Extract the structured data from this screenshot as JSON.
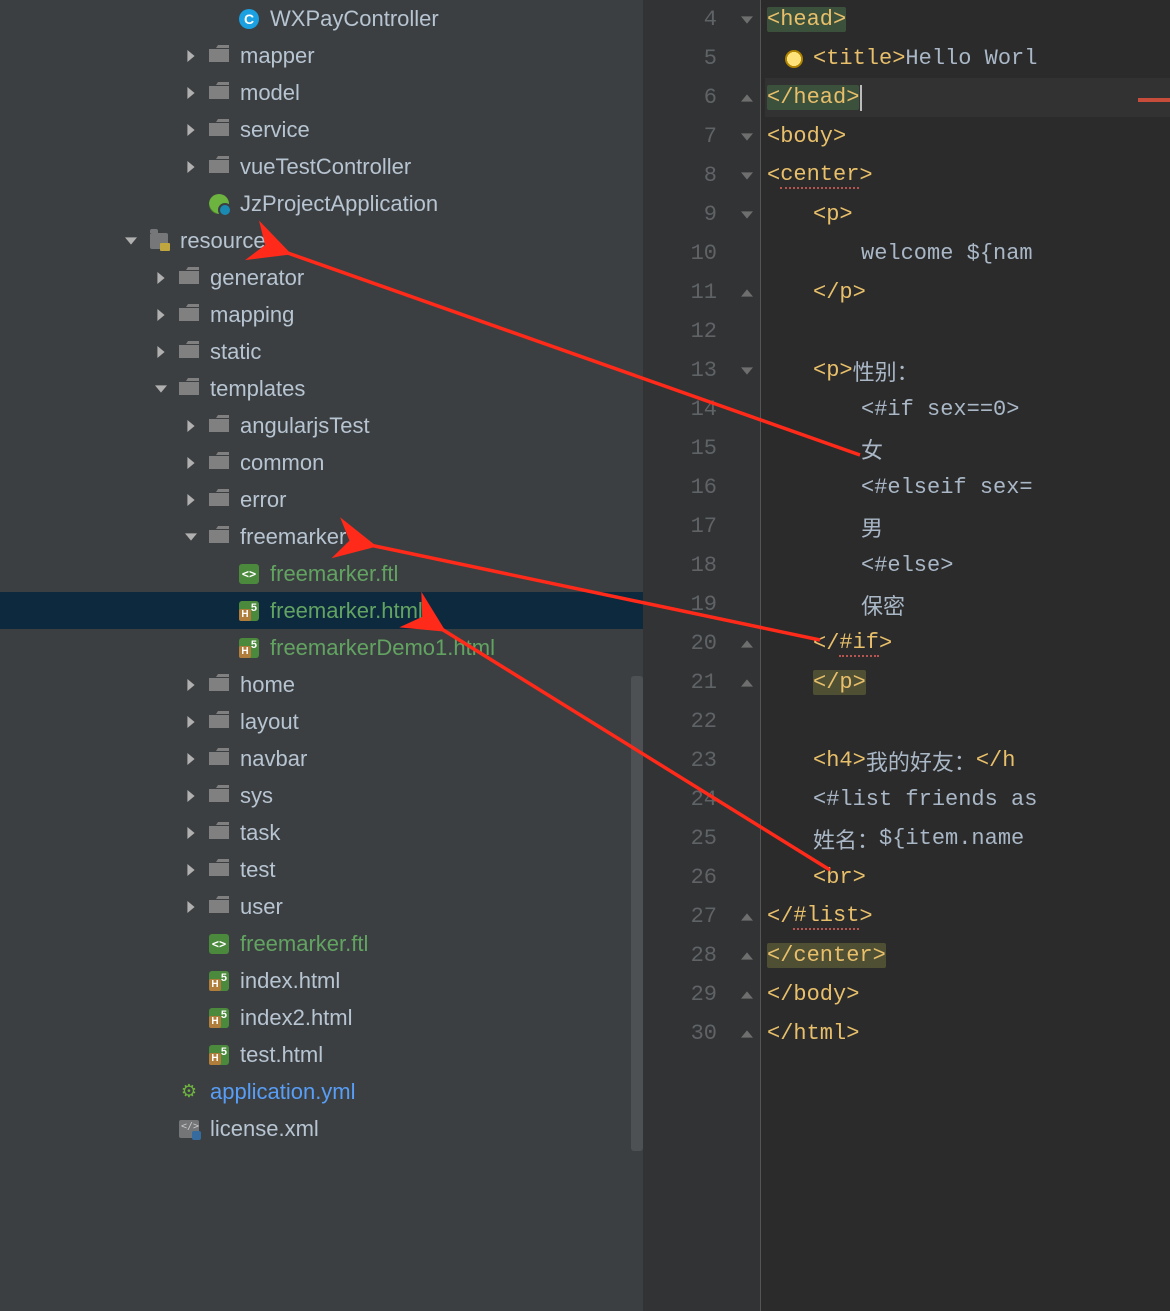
{
  "tree": {
    "rows": [
      {
        "depth": 5,
        "arrow": "none",
        "icon": "class",
        "label": "WXPayController",
        "cls": ""
      },
      {
        "depth": 4,
        "arrow": "right",
        "icon": "folder",
        "label": "mapper",
        "cls": ""
      },
      {
        "depth": 4,
        "arrow": "right",
        "icon": "folder",
        "label": "model",
        "cls": ""
      },
      {
        "depth": 4,
        "arrow": "right",
        "icon": "folder",
        "label": "service",
        "cls": ""
      },
      {
        "depth": 4,
        "arrow": "right",
        "icon": "folder",
        "label": "vueTestController",
        "cls": ""
      },
      {
        "depth": 4,
        "arrow": "none",
        "icon": "spring",
        "label": "JzProjectApplication",
        "cls": ""
      },
      {
        "depth": 2,
        "arrow": "down",
        "icon": "res",
        "label": "resources",
        "cls": ""
      },
      {
        "depth": 3,
        "arrow": "right",
        "icon": "folder",
        "label": "generator",
        "cls": ""
      },
      {
        "depth": 3,
        "arrow": "right",
        "icon": "folder",
        "label": "mapping",
        "cls": ""
      },
      {
        "depth": 3,
        "arrow": "right",
        "icon": "folder",
        "label": "static",
        "cls": ""
      },
      {
        "depth": 3,
        "arrow": "down",
        "icon": "folder",
        "label": "templates",
        "cls": ""
      },
      {
        "depth": 4,
        "arrow": "right",
        "icon": "folder",
        "label": "angularjsTest",
        "cls": ""
      },
      {
        "depth": 4,
        "arrow": "right",
        "icon": "folder",
        "label": "common",
        "cls": ""
      },
      {
        "depth": 4,
        "arrow": "right",
        "icon": "folder",
        "label": "error",
        "cls": ""
      },
      {
        "depth": 4,
        "arrow": "down",
        "icon": "folder",
        "label": "freemarker",
        "cls": ""
      },
      {
        "depth": 5,
        "arrow": "none",
        "icon": "ftl",
        "label": "freemarker.ftl",
        "cls": "green"
      },
      {
        "depth": 5,
        "arrow": "none",
        "icon": "html",
        "label": "freemarker.html",
        "cls": "green",
        "selected": true
      },
      {
        "depth": 5,
        "arrow": "none",
        "icon": "html",
        "label": "freemarkerDemo1.html",
        "cls": "green"
      },
      {
        "depth": 4,
        "arrow": "right",
        "icon": "folder",
        "label": "home",
        "cls": ""
      },
      {
        "depth": 4,
        "arrow": "right",
        "icon": "folder",
        "label": "layout",
        "cls": ""
      },
      {
        "depth": 4,
        "arrow": "right",
        "icon": "folder",
        "label": "navbar",
        "cls": ""
      },
      {
        "depth": 4,
        "arrow": "right",
        "icon": "folder",
        "label": "sys",
        "cls": ""
      },
      {
        "depth": 4,
        "arrow": "right",
        "icon": "folder",
        "label": "task",
        "cls": ""
      },
      {
        "depth": 4,
        "arrow": "right",
        "icon": "folder",
        "label": "test",
        "cls": ""
      },
      {
        "depth": 4,
        "arrow": "right",
        "icon": "folder",
        "label": "user",
        "cls": ""
      },
      {
        "depth": 4,
        "arrow": "none",
        "icon": "ftl",
        "label": "freemarker.ftl",
        "cls": "green"
      },
      {
        "depth": 4,
        "arrow": "none",
        "icon": "html",
        "label": "index.html",
        "cls": ""
      },
      {
        "depth": 4,
        "arrow": "none",
        "icon": "html",
        "label": "index2.html",
        "cls": ""
      },
      {
        "depth": 4,
        "arrow": "none",
        "icon": "html",
        "label": "test.html",
        "cls": ""
      },
      {
        "depth": 3,
        "arrow": "none",
        "icon": "yml",
        "label": "application.yml",
        "cls": "blue"
      },
      {
        "depth": 3,
        "arrow": "none",
        "icon": "xml",
        "label": "license.xml",
        "cls": ""
      }
    ]
  },
  "gutter_start": 4,
  "gutter_end": 30,
  "code": {
    "l4": {
      "open": "<",
      "tag": "head",
      "close": ">"
    },
    "l5": {
      "open": "<",
      "tag": "title",
      "close": ">",
      "text": "Hello Worl"
    },
    "l6": {
      "open": "</",
      "tag": "head",
      "close": ">"
    },
    "l7": {
      "open": "<",
      "tag": "body",
      "close": ">"
    },
    "l8": {
      "open": "<",
      "tag": "center",
      "close": ">"
    },
    "l9": {
      "open": "<",
      "tag": "p",
      "close": ">"
    },
    "l10": {
      "text": "welcome ${nam"
    },
    "l11": {
      "open": "</",
      "tag": "p",
      "close": ">"
    },
    "l13": {
      "open": "<",
      "tag": "p",
      "close": ">",
      "text_cn": "性别："
    },
    "l14": {
      "text": "<#if sex==0>"
    },
    "l15": {
      "text_cn": "女"
    },
    "l16": {
      "text": "<#elseif sex="
    },
    "l17": {
      "text_cn": "男"
    },
    "l18": {
      "text": "<#else>"
    },
    "l19": {
      "text_cn": "保密"
    },
    "l20": {
      "open": "</",
      "tag": "#if",
      "close": ">"
    },
    "l21": {
      "open": "</",
      "tag": "p",
      "close": ">"
    },
    "l23": {
      "open": "<",
      "tag": "h4",
      "close": ">",
      "text_cn": "我的好友：",
      "open2": "</",
      "tag2": "h"
    },
    "l24": {
      "text": "<#list friends as "
    },
    "l25": {
      "text_cn": "姓名：",
      "text2": "${item.name"
    },
    "l26": {
      "open": "<",
      "tag": "br",
      "close": ">"
    },
    "l27": {
      "open": "</",
      "tag": "#list",
      "close": ">"
    },
    "l28": {
      "open": "</",
      "tag": "center",
      "close": ">"
    },
    "l29": {
      "open": "</",
      "tag": "body",
      "close": ">"
    },
    "l30": {
      "open": "</",
      "tag": "html",
      "close": ">"
    }
  }
}
